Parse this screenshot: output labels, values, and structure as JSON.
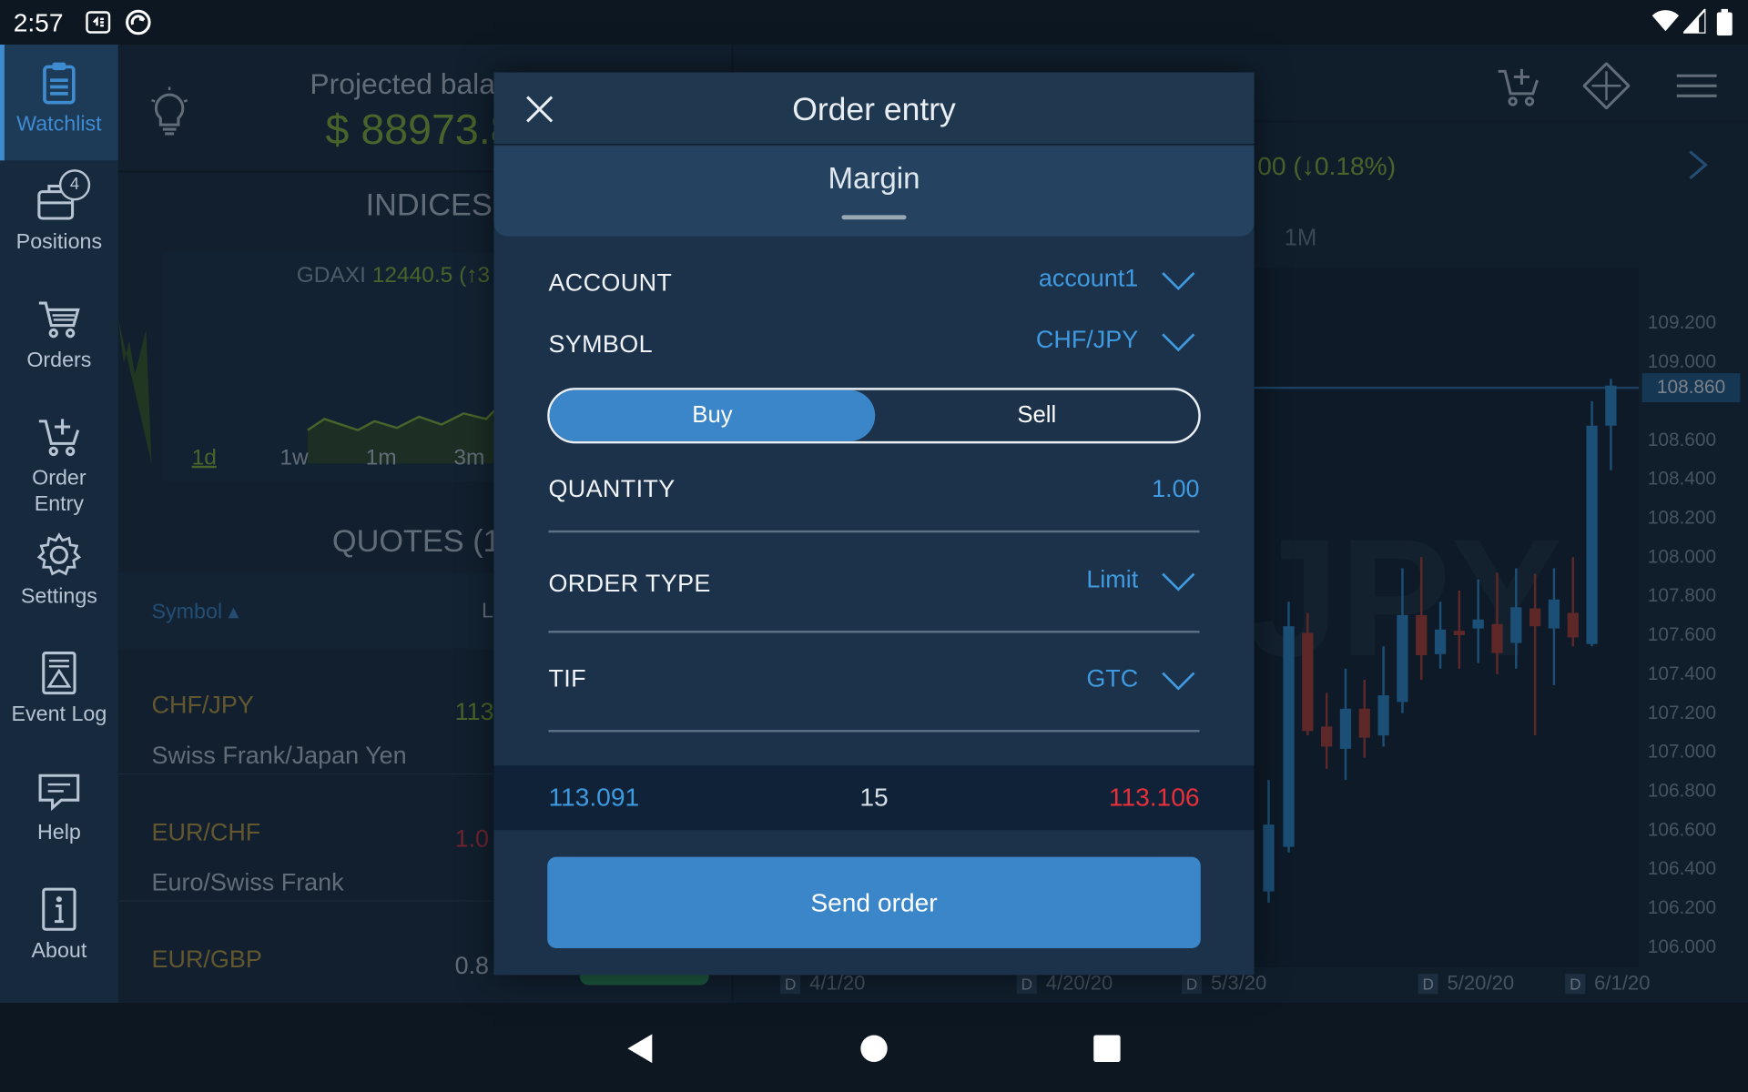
{
  "status_bar": {
    "time": "2:57"
  },
  "sidebar": {
    "items": [
      {
        "label": "Watchlist",
        "icon": "clipboard-icon",
        "active": true
      },
      {
        "label": "Positions",
        "icon": "briefcase-icon",
        "badge": "4"
      },
      {
        "label": "Orders",
        "icon": "cart-icon"
      },
      {
        "label": "Order Entry",
        "icon": "cart-plus-icon"
      },
      {
        "label": "Settings",
        "icon": "gear-icon"
      },
      {
        "label": "Event Log",
        "icon": "event-log-icon"
      },
      {
        "label": "Help",
        "icon": "chat-icon"
      },
      {
        "label": "About",
        "icon": "info-icon"
      }
    ]
  },
  "background": {
    "projected_label": "Projected bala",
    "projected_value": "$ 88973.8",
    "indices_title": "INDICES",
    "index_symbol": "GDAXI",
    "index_value": "12440.5 (↑3",
    "ranges": [
      "1d",
      "1w",
      "1m",
      "3m"
    ],
    "quotes_title": "QUOTES (1",
    "symbol_column": "Symbol ▴",
    "last_column_initial": "L",
    "quotes": [
      {
        "symbol": "CHF/JPY",
        "description": "Swiss Frank/Japan Yen",
        "value": "113"
      },
      {
        "symbol": "EUR/CHF",
        "description": "Euro/Swiss Frank",
        "value": "1.0"
      },
      {
        "symbol": "EUR/GBP",
        "description": "",
        "value": "0.8"
      }
    ],
    "chart_change": "00 (↓0.18%)",
    "chart_tab": "1M",
    "watermark": "JPY",
    "y_ticks": [
      "109.200",
      "109.000",
      "108.600",
      "108.400",
      "108.200",
      "108.000",
      "107.800",
      "107.600",
      "107.400",
      "107.200",
      "107.000",
      "106.800",
      "106.600",
      "106.400",
      "106.200",
      "106.000"
    ],
    "last_price": "108.860",
    "x_ticks": [
      {
        "flag": "D",
        "date": "4/1/20"
      },
      {
        "flag": "D",
        "date": "4/20/20"
      },
      {
        "flag": "D",
        "date": "5/3/20"
      },
      {
        "flag": "D",
        "date": "5/20/20"
      },
      {
        "flag": "D",
        "date": "6/1/20"
      }
    ],
    "colors": {
      "up": "#2c8fd6",
      "down": "#c0392b",
      "accent_green": "#8fbf2f",
      "gold": "#c9a23a"
    }
  },
  "modal": {
    "title": "Order entry",
    "tab": "Margin",
    "account_label": "ACCOUNT",
    "account_value": "account1",
    "symbol_label": "SYMBOL",
    "symbol_value": "CHF/JPY",
    "buy_label": "Buy",
    "sell_label": "Sell",
    "side_selected": "Buy",
    "quantity_label": "QUANTITY",
    "quantity_value": "1.00",
    "order_type_label": "ORDER TYPE",
    "order_type_value": "Limit",
    "tif_label": "TIF",
    "tif_value": "GTC",
    "bid": "113.091",
    "spread": "15",
    "ask": "113.106",
    "send_label": "Send order",
    "colors": {
      "accent": "#3a86c8",
      "value_blue": "#3f9ae0",
      "ask_red": "#e8303a"
    }
  }
}
